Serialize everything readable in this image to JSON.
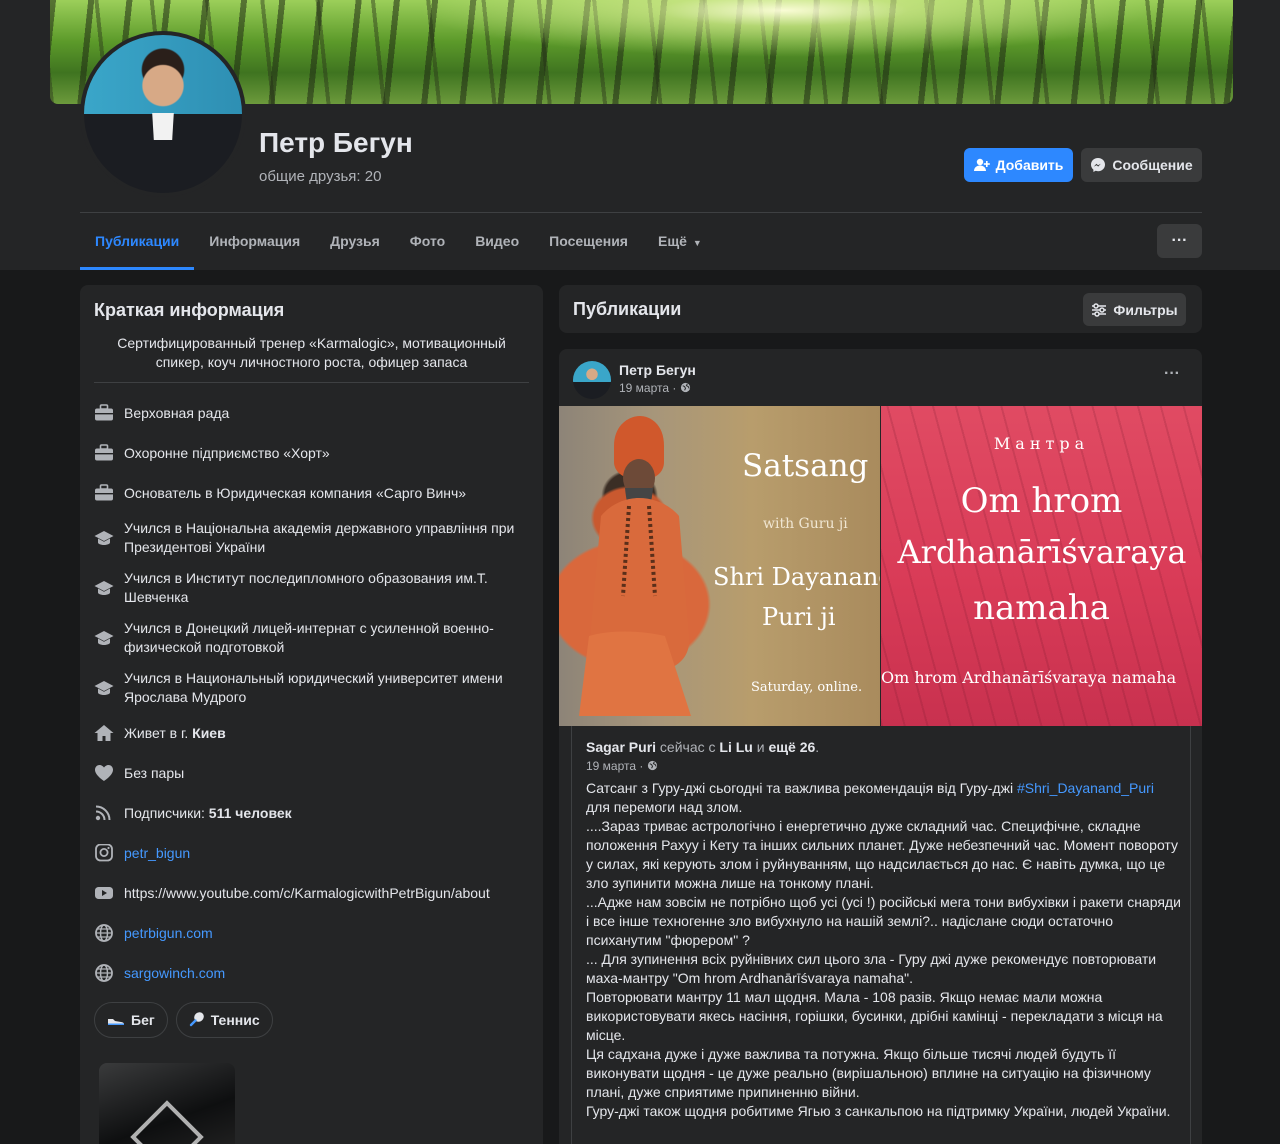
{
  "profile": {
    "name": "Петр Бегун",
    "mutual_friends": "общие друзья: 20",
    "add_label": "Добавить",
    "message_label": "Сообщение"
  },
  "tabs": [
    {
      "label": "Публикации",
      "active": true
    },
    {
      "label": "Информация"
    },
    {
      "label": "Друзья"
    },
    {
      "label": "Фото"
    },
    {
      "label": "Видео"
    },
    {
      "label": "Посещения"
    },
    {
      "label": "Ещё"
    }
  ],
  "intro": {
    "title": "Краткая информация",
    "bio": "Сертифицированный тренер «Karmalogic», мотивационный спикер, коуч личностного роста, офицер запаса",
    "items": [
      {
        "icon": "briefcase-icon",
        "text": "Верховная рада"
      },
      {
        "icon": "briefcase-icon",
        "text": "Охоронне підприємство «Хорт»"
      },
      {
        "icon": "briefcase-icon",
        "text": "Основатель в Юридическая компания «Сарго Винч»"
      },
      {
        "icon": "graduation-cap-icon",
        "text": "Учился в Національна академія державного управління при Президентові України"
      },
      {
        "icon": "graduation-cap-icon",
        "text": "Учился в Институт последипломного образования им.Т. Шевченка"
      },
      {
        "icon": "graduation-cap-icon",
        "text": "Учился в Донецкий лицей-интернат с усиленной военно-физической подготовкой"
      },
      {
        "icon": "graduation-cap-icon",
        "text": "Учился в Национальный юридический университет имени Ярослава Мудрого"
      },
      {
        "icon": "home-icon",
        "prefix": "Живет в г. ",
        "bold": "Киев"
      },
      {
        "icon": "heart-icon",
        "text": "Без пары"
      },
      {
        "icon": "rss-icon",
        "prefix": "Подписчики: ",
        "bold": "511 человек"
      },
      {
        "icon": "instagram-icon",
        "link": "petr_bigun"
      },
      {
        "icon": "youtube-icon",
        "text": "https://www.youtube.com/c/KarmalogicwithPetrBigun/about"
      },
      {
        "icon": "globe-icon",
        "link": "petrbigun.com"
      },
      {
        "icon": "globe-icon",
        "link": "sargowinch.com"
      }
    ],
    "hobbies": [
      {
        "icon": "sneaker-icon",
        "label": "Бег"
      },
      {
        "icon": "tennis-racket-icon",
        "label": "Теннис"
      }
    ]
  },
  "posts_header": {
    "title": "Публикации",
    "filter_label": "Фильтры"
  },
  "post": {
    "author": "Петр Бегун",
    "date": "19 марта ·",
    "image_left": {
      "title": "Satsang",
      "subtitle": "with Guru ji",
      "name_line1": "Shri Dayanand",
      "name_line2": "Puri   ji",
      "footer": "Saturday, online."
    },
    "image_right": {
      "title": "Мантра",
      "line1": "Om hrom",
      "line2": "Ardhanārīśvaraya",
      "line3": "namaha",
      "footer": "Om hrom Ardhanārīśvaraya namaha"
    },
    "shared": {
      "author": "Sagar Puri",
      "status": " сейчас с ",
      "with": "Li Lu",
      "and": " и ",
      "others": "ещё 26",
      "date": "19 марта ·",
      "text_start": "Сатсанг з Гуру-джі сьогодні та важлива рекомендація від Гуру-джі ",
      "hashtag": "#Shri_Dayanand_Puri",
      "text_after_hashtag": "для перемоги над злом.",
      "paragraphs": [
        "....Зараз триває астрологічно і енергетично дуже складний час. Специфічне, складне положення Рахуу і Кету та інших сильних планет. Дуже небезпечний час. Момент повороту у силах, які керують злом і руйнуванням, що надсилається до нас. Є навіть думка, що це зло зупинити можна лише на тонкому плані.",
        "...Адже нам зовсім не потрібно щоб усі (усі !) російські мега тони вибухівки і ракети снаряди і все інше техногенне зло вибухнуло на нашій землі?.. надіслане сюди остаточно психанутим \"фюрером\" ?",
        "... Для зупинення всіх руйнівних сил цього зла  - Гуру джі дуже рекомендує повторювати маха-мантру \"Om hrom Ardhanārīśvaraya namaha\".",
        "Повторювати мантру  11 мал щодня. Мала - 108 разів. Якщо немає мали можна використовувати якесь насіння, горішки, бусинки, дрібні камінці - перекладати з місця на місце.",
        "Ця садхана дуже і дуже важлива та потужна. Якщо більше тисячі людей будуть її виконувати щодня - це дуже реально (вирішальною) вплине на ситуацію на фізичному плані, дуже сприятиме припиненню війни.",
        "Гуру-джі також щодня робитиме Ягью з санкальпою на підтримку України, людей України."
      ]
    }
  },
  "colors": {
    "background": "#18191a",
    "card": "#242526",
    "accent": "#2d88ff",
    "link": "#4599ff",
    "text": "#e4e6eb",
    "secondary_text": "#b0b3b8"
  }
}
